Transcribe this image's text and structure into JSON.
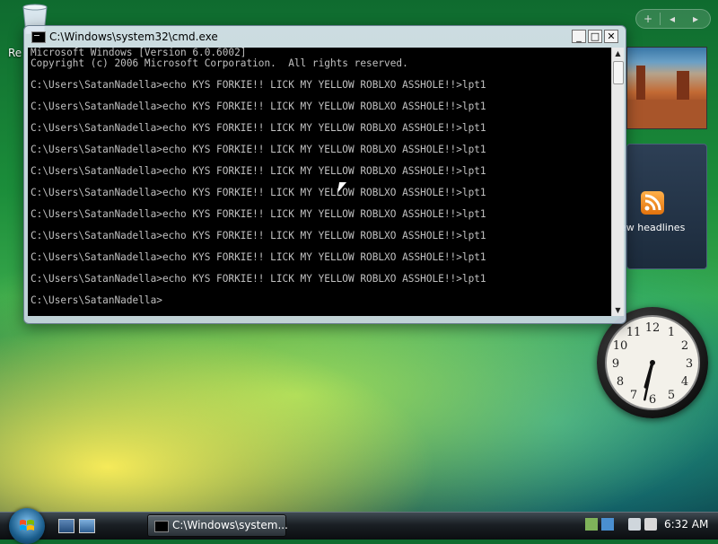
{
  "desktop": {
    "icon_label": "Re"
  },
  "sidebar": {
    "controls": {
      "add": "+",
      "prev": "◂",
      "next": "▸"
    },
    "feed_label": "ew headlines"
  },
  "clock": {
    "hour": 6,
    "minute": 32
  },
  "window": {
    "title": "C:\\Windows\\system32\\cmd.exe",
    "buttons": {
      "minimize": "_",
      "maximize": "□",
      "close": "✕"
    },
    "console_lines": [
      "Microsoft Windows [Version 6.0.6002]",
      "Copyright (c) 2006 Microsoft Corporation.  All rights reserved.",
      "",
      "C:\\Users\\SatanNadella>echo KYS FORKIE!! LICK MY YELLOW ROBLXO ASSHOLE!!>lpt1",
      "",
      "C:\\Users\\SatanNadella>echo KYS FORKIE!! LICK MY YELLOW ROBLXO ASSHOLE!!>lpt1",
      "",
      "C:\\Users\\SatanNadella>echo KYS FORKIE!! LICK MY YELLOW ROBLXO ASSHOLE!!>lpt1",
      "",
      "C:\\Users\\SatanNadella>echo KYS FORKIE!! LICK MY YELLOW ROBLXO ASSHOLE!!>lpt1",
      "",
      "C:\\Users\\SatanNadella>echo KYS FORKIE!! LICK MY YELLOW ROBLXO ASSHOLE!!>lpt1",
      "",
      "C:\\Users\\SatanNadella>echo KYS FORKIE!! LICK MY YELLOW ROBLXO ASSHOLE!!>lpt1",
      "",
      "C:\\Users\\SatanNadella>echo KYS FORKIE!! LICK MY YELLOW ROBLXO ASSHOLE!!>lpt1",
      "",
      "C:\\Users\\SatanNadella>echo KYS FORKIE!! LICK MY YELLOW ROBLXO ASSHOLE!!>lpt1",
      "",
      "C:\\Users\\SatanNadella>echo KYS FORKIE!! LICK MY YELLOW ROBLXO ASSHOLE!!>lpt1",
      "",
      "C:\\Users\\SatanNadella>echo KYS FORKIE!! LICK MY YELLOW ROBLXO ASSHOLE!!>lpt1",
      "",
      "C:\\Users\\SatanNadella>"
    ],
    "scroll": {
      "up": "▲",
      "down": "▼"
    }
  },
  "taskbar": {
    "task_button_label": "C:\\Windows\\system...",
    "time": "6:32 AM"
  },
  "colors": {
    "console_bg": "#000000",
    "console_fg": "#c0c0c0",
    "accent_rss": "#f08a1c"
  },
  "icons": [
    "recycle-bin-icon",
    "cmd-icon",
    "rss-icon",
    "windows-start-icon",
    "show-desktop-icon",
    "switch-windows-icon",
    "network-icon",
    "volume-icon"
  ]
}
